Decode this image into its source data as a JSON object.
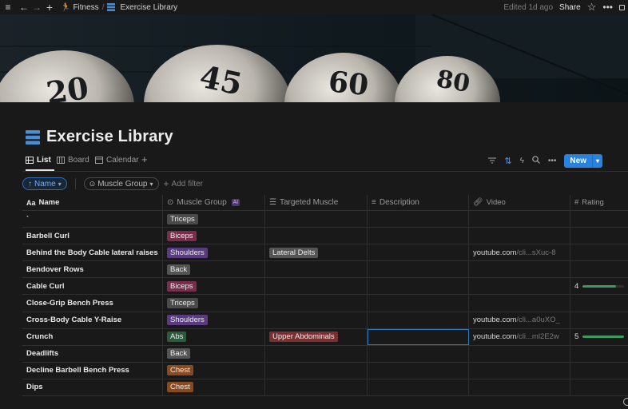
{
  "topbar": {
    "workspace": "Fitness",
    "page": "Exercise Library",
    "edited": "Edited 1d ago",
    "share": "Share"
  },
  "page": {
    "title": "Exercise Library",
    "title_icon": "database-icon"
  },
  "cover": {
    "balls": [
      "20",
      "45",
      "60",
      "80"
    ]
  },
  "views": {
    "tabs": [
      {
        "label": "List",
        "icon": "list-icon",
        "active": true
      },
      {
        "label": "Board",
        "icon": "board-icon",
        "active": false
      },
      {
        "label": "Calendar",
        "icon": "calendar-icon",
        "active": false
      }
    ],
    "add_view": "+",
    "new_label": "New"
  },
  "filters": {
    "sort_label": "Name",
    "group_label": "Muscle Group",
    "add_filter": "Add filter"
  },
  "table": {
    "columns": [
      {
        "label": "Name",
        "icon": "Aa"
      },
      {
        "label": "Muscle Group",
        "icon": "select-icon",
        "badge": "AI"
      },
      {
        "label": "Targeted Muscle",
        "icon": "multi-select-icon"
      },
      {
        "label": "Description",
        "icon": "text-icon"
      },
      {
        "label": "Video",
        "icon": "link-icon"
      },
      {
        "label": "Rating",
        "icon": "#"
      }
    ],
    "rows": [
      {
        "name": "`",
        "muscle_group": "Triceps",
        "targeted": "",
        "video_domain": "",
        "video_rest": "",
        "rating": ""
      },
      {
        "name": "Barbell Curl",
        "muscle_group": "Biceps",
        "targeted": "",
        "video_domain": "",
        "video_rest": "",
        "rating": ""
      },
      {
        "name": "Behind the Body Cable lateral raises",
        "muscle_group": "Shoulders",
        "targeted": "Lateral Delts",
        "video_domain": "youtube.com",
        "video_rest": "/cli...sXuc-8",
        "rating": ""
      },
      {
        "name": "Bendover Rows",
        "muscle_group": "Back",
        "targeted": "",
        "video_domain": "",
        "video_rest": "",
        "rating": ""
      },
      {
        "name": "Cable Curl",
        "muscle_group": "Biceps",
        "targeted": "",
        "video_domain": "",
        "video_rest": "",
        "rating": "4"
      },
      {
        "name": "Close-Grip Bench Press",
        "muscle_group": "Triceps",
        "targeted": "",
        "video_domain": "",
        "video_rest": "",
        "rating": ""
      },
      {
        "name": "Cross-Body Cable Y-Raise",
        "muscle_group": "Shoulders",
        "targeted": "",
        "video_domain": "youtube.com",
        "video_rest": "/cli...a0uXO_",
        "rating": ""
      },
      {
        "name": "Crunch",
        "muscle_group": "Abs",
        "targeted": "Upper Abdominals",
        "video_domain": "youtube.com",
        "video_rest": "/cli...ml2E2w",
        "rating": "5"
      },
      {
        "name": "Deadlifts",
        "muscle_group": "Back",
        "targeted": "",
        "video_domain": "",
        "video_rest": "",
        "rating": ""
      },
      {
        "name": "Decline Barbell Bench Press",
        "muscle_group": "Chest",
        "targeted": "",
        "video_domain": "",
        "video_rest": "",
        "rating": ""
      },
      {
        "name": "Dips",
        "muscle_group": "Chest",
        "targeted": "",
        "video_domain": "",
        "video_rest": "",
        "rating": ""
      }
    ]
  },
  "tag_colors": {
    "Triceps": "#4a4a4a",
    "Biceps": "#7a2d4a",
    "Shoulders": "#5a3a82",
    "Back": "#545454",
    "Abs": "#2b5a3e",
    "Chest": "#8a4a1e",
    "Lateral Delts": "#545454",
    "Upper Abdominals": "#7a3030"
  },
  "rating_bar_color": "#3b9a5f",
  "rating_max": 5
}
